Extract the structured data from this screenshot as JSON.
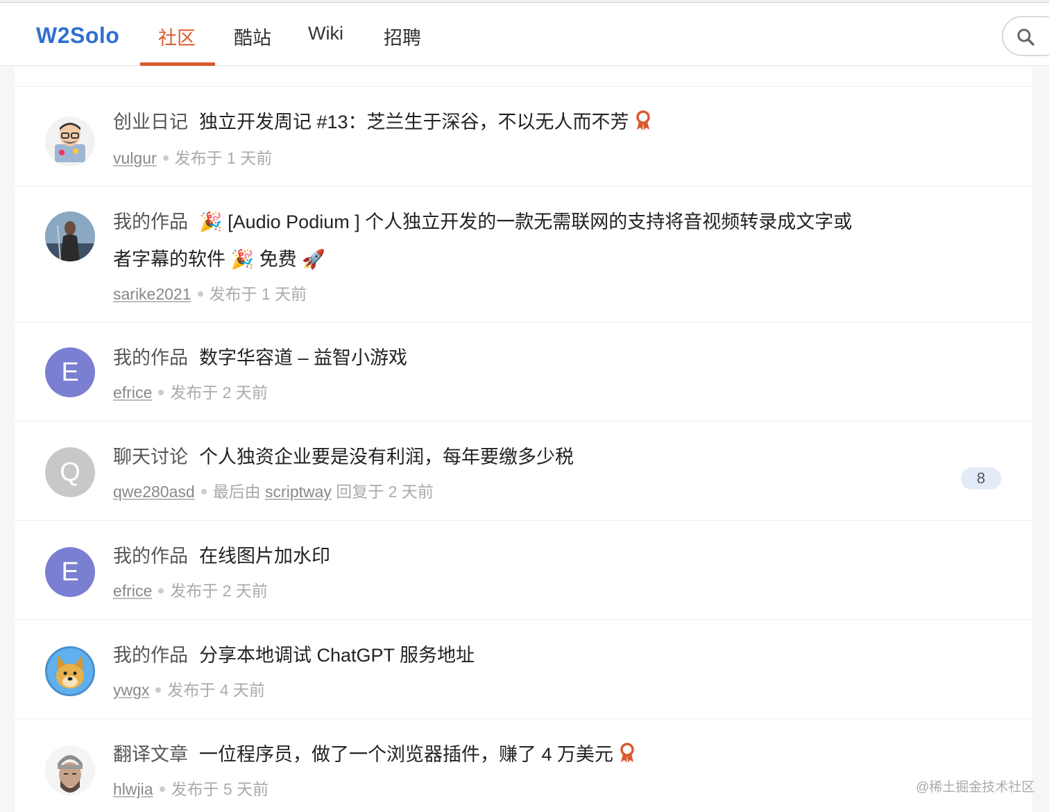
{
  "header": {
    "logo": "W2Solo",
    "nav": [
      {
        "label": "社区",
        "active": true
      },
      {
        "label": "酷站",
        "active": false
      },
      {
        "label": "Wiki",
        "active": false
      },
      {
        "label": "招聘",
        "active": false
      }
    ],
    "search_icon": "search-icon",
    "accent_color": "#d9592d",
    "logo_color": "#2f6fd1"
  },
  "topics": [
    {
      "category": "创业日记",
      "title": "独立开发周记 #13：芝兰生于深谷，不以无人而不芳",
      "title_line2": "",
      "featured": true,
      "author": "vulgur",
      "meta_action": "发布于 1 天前",
      "last_replier": "",
      "reply_count": "",
      "avatar": {
        "type": "memoji",
        "letter": ""
      }
    },
    {
      "category": "我的作品",
      "title": "🎉 [Audio Podium ] 个人独立开发的一款无需联网的支持将音视频转录成文字或",
      "title_line2": "者字幕的软件 🎉 免费 🚀",
      "featured": false,
      "author": "sarike2021",
      "meta_action": "发布于 1 天前",
      "last_replier": "",
      "reply_count": "",
      "avatar": {
        "type": "photo",
        "letter": ""
      }
    },
    {
      "category": "我的作品",
      "title": "数字华容道 – 益智小游戏",
      "title_line2": "",
      "featured": false,
      "author": "efrice",
      "meta_action": "发布于 2 天前",
      "last_replier": "",
      "reply_count": "",
      "avatar": {
        "type": "letter",
        "letter": "E",
        "color": "#7a7fd1"
      }
    },
    {
      "category": "聊天讨论",
      "title": "个人独资企业要是没有利润，每年要缴多少税",
      "title_line2": "",
      "featured": false,
      "author": "qwe280asd",
      "meta_prefix": "最后由",
      "last_replier": "scriptway",
      "meta_action": "回复于 2 天前",
      "reply_count": "8",
      "avatar": {
        "type": "letter",
        "letter": "Q",
        "color": "#c8c8c8"
      }
    },
    {
      "category": "我的作品",
      "title": "在线图片加水印",
      "title_line2": "",
      "featured": false,
      "author": "efrice",
      "meta_action": "发布于 2 天前",
      "last_replier": "",
      "reply_count": "",
      "avatar": {
        "type": "letter",
        "letter": "E",
        "color": "#7a7fd1"
      }
    },
    {
      "category": "我的作品",
      "title": "分享本地调试 ChatGPT 服务地址",
      "title_line2": "",
      "featured": false,
      "author": "ywgx",
      "meta_action": "发布于 4 天前",
      "last_replier": "",
      "reply_count": "",
      "avatar": {
        "type": "doge",
        "letter": ""
      }
    },
    {
      "category": "翻译文章",
      "title": "一位程序员，做了一个浏览器插件，赚了 4 万美元",
      "title_line2": "",
      "featured": true,
      "author": "hlwjia",
      "meta_action": "发布于 5 天前",
      "last_replier": "",
      "reply_count": "",
      "avatar": {
        "type": "photo2",
        "letter": ""
      }
    }
  ],
  "watermark": "@稀土掘金技术社区"
}
